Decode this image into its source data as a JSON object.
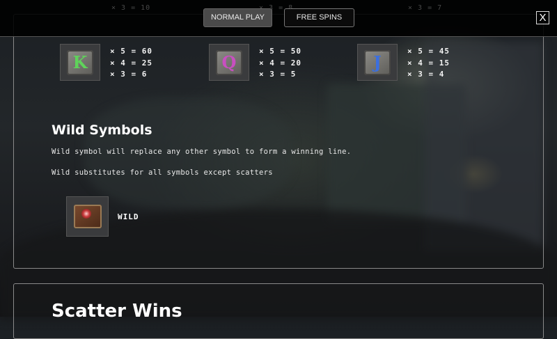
{
  "topbar": {
    "ghost_paytable": [
      "× 3 = 10",
      "× 3 = 8",
      "× 3 = 7"
    ],
    "tabs": [
      {
        "label": "NORMAL PLAY",
        "active": true
      },
      {
        "label": "FREE SPINS",
        "active": false
      }
    ],
    "close_label": "X"
  },
  "paytable": [
    {
      "letter": "K",
      "color": "#5fd35a",
      "icon": "k-symbol-icon",
      "pays": [
        "× 5 = 60",
        "× 4 = 25",
        "× 3 = 6"
      ]
    },
    {
      "letter": "Q",
      "color": "#c84fc0",
      "icon": "q-symbol-icon",
      "pays": [
        "× 5 = 50",
        "× 4 = 20",
        "× 3 = 5"
      ]
    },
    {
      "letter": "J",
      "color": "#3b6fe0",
      "icon": "j-symbol-icon",
      "pays": [
        "× 5 = 45",
        "× 4 = 15",
        "× 3 = 4"
      ]
    }
  ],
  "wild": {
    "heading": "Wild Symbols",
    "line1": "Wild symbol will replace any other symbol to form a winning line.",
    "line2": "Wild substitutes for all symbols except scatters",
    "symbol_icon": "spellbook-icon",
    "label": "WILD"
  },
  "scatter": {
    "heading": "Scatter Wins"
  }
}
